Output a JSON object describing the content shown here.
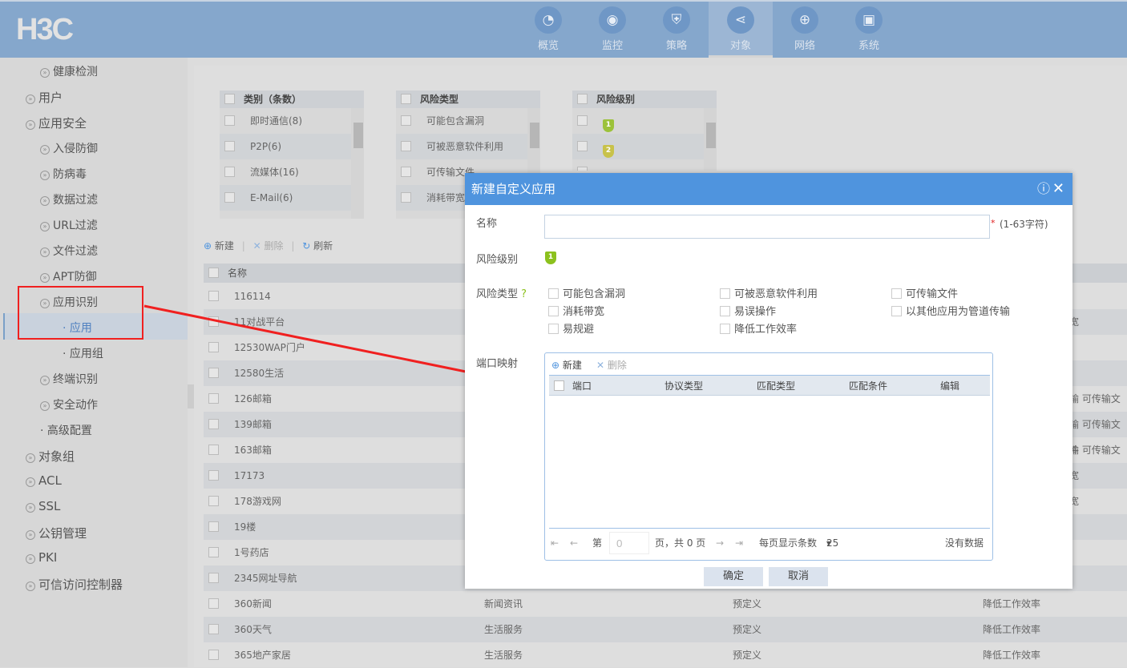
{
  "header": {
    "logo": "H3C",
    "nav": [
      {
        "label": "概览",
        "icon": "dashboard-icon"
      },
      {
        "label": "监控",
        "icon": "camera-icon"
      },
      {
        "label": "策略",
        "icon": "shield-icon"
      },
      {
        "label": "对象",
        "icon": "share-icon",
        "active": true
      },
      {
        "label": "网络",
        "icon": "globe-icon"
      },
      {
        "label": "系统",
        "icon": "monitor-icon"
      }
    ]
  },
  "sidebar": {
    "items": [
      {
        "label": "健康检测",
        "level": 1
      },
      {
        "label": "用户",
        "level": 0
      },
      {
        "label": "应用安全",
        "level": 0
      },
      {
        "label": "入侵防御",
        "level": 1
      },
      {
        "label": "防病毒",
        "level": 1
      },
      {
        "label": "数据过滤",
        "level": 1
      },
      {
        "label": "URL过滤",
        "level": 1
      },
      {
        "label": "文件过滤",
        "level": 1
      },
      {
        "label": "APT防御",
        "level": 1
      },
      {
        "label": "应用识别",
        "level": 1
      },
      {
        "label": "· 应用",
        "level": 2,
        "selected": true
      },
      {
        "label": "· 应用组",
        "level": 2
      },
      {
        "label": "终端识别",
        "level": 1
      },
      {
        "label": "安全动作",
        "level": 1
      },
      {
        "label": "· 高级配置",
        "level": 1
      },
      {
        "label": "对象组",
        "level": 0
      },
      {
        "label": "ACL",
        "level": 0
      },
      {
        "label": "SSL",
        "level": 0
      },
      {
        "label": "公钥管理",
        "level": 0
      },
      {
        "label": "PKI",
        "level": 0
      },
      {
        "label": "可信访问控制器",
        "level": 0
      }
    ]
  },
  "filters": [
    {
      "header": "类别（条数）",
      "items": [
        "即时通信(8)",
        "P2P(6)",
        "流媒体(16)",
        "E-Mail(6)"
      ]
    },
    {
      "header": "风险类型",
      "items": [
        "可能包含漏洞",
        "可被恶意软件利用",
        "可传输文件",
        "消耗带宽"
      ]
    },
    {
      "header": "风险级别",
      "items": [
        "1",
        "2",
        "3"
      ]
    }
  ],
  "toolbar": {
    "new": "新建",
    "delete": "删除",
    "refresh": "刷新"
  },
  "table": {
    "header": "名称",
    "rows": [
      [
        "116114",
        "",
        "",
        ""
      ],
      [
        "11对战平台",
        "",
        "",
        "宽"
      ],
      [
        "12530WAP门户",
        "",
        "",
        ""
      ],
      [
        "12580生活",
        "",
        "",
        ""
      ],
      [
        "126邮箱",
        "",
        "",
        "输 可传输文件"
      ],
      [
        "139邮箱",
        "",
        "",
        "输 可传输文件"
      ],
      [
        "163邮箱",
        "",
        "",
        "输 可传输文件"
      ],
      [
        "17173",
        "",
        "",
        "宽"
      ],
      [
        "178游戏网",
        "",
        "",
        "宽"
      ],
      [
        "19楼",
        "",
        "",
        ""
      ],
      [
        "1号药店",
        "",
        "",
        ""
      ],
      [
        "2345网址导航",
        "",
        "",
        ""
      ],
      [
        "360新闻",
        "新闻资讯",
        "预定义",
        "降低工作效率"
      ],
      [
        "360天气",
        "生活服务",
        "预定义",
        "降低工作效率"
      ],
      [
        "365地产家居",
        "生活服务",
        "预定义",
        "降低工作效率"
      ]
    ]
  },
  "dialog": {
    "title": "新建自定义应用",
    "name_label": "名称",
    "name_value": "",
    "required": "*",
    "name_hint": "(1-63字符)",
    "risk_level_label": "风险级别",
    "risk_level": "1",
    "risk_type_label": "风险类型",
    "risk_types": [
      "可能包含漏洞",
      "可被恶意软件利用",
      "可传输文件",
      "消耗带宽",
      "易误操作",
      "以其他应用为管道传输",
      "易规避",
      "降低工作效率"
    ],
    "port_label": "端口映射",
    "port_new": "新建",
    "port_delete": "删除",
    "port_columns": [
      "端口",
      "协议类型",
      "匹配类型",
      "匹配条件",
      "编辑"
    ],
    "page_prefix": "第",
    "page_value": "0",
    "page_suffix": "页，共 0 页",
    "per_page_label": "每页显示条数",
    "per_page": "25",
    "no_data": "没有数据",
    "ok": "确定",
    "cancel": "取消"
  },
  "colors": {
    "header": "#85a7cc",
    "dialog_title": "#4f94de",
    "risk_level_1": "#8cc11e",
    "annotation": "#f02020"
  }
}
